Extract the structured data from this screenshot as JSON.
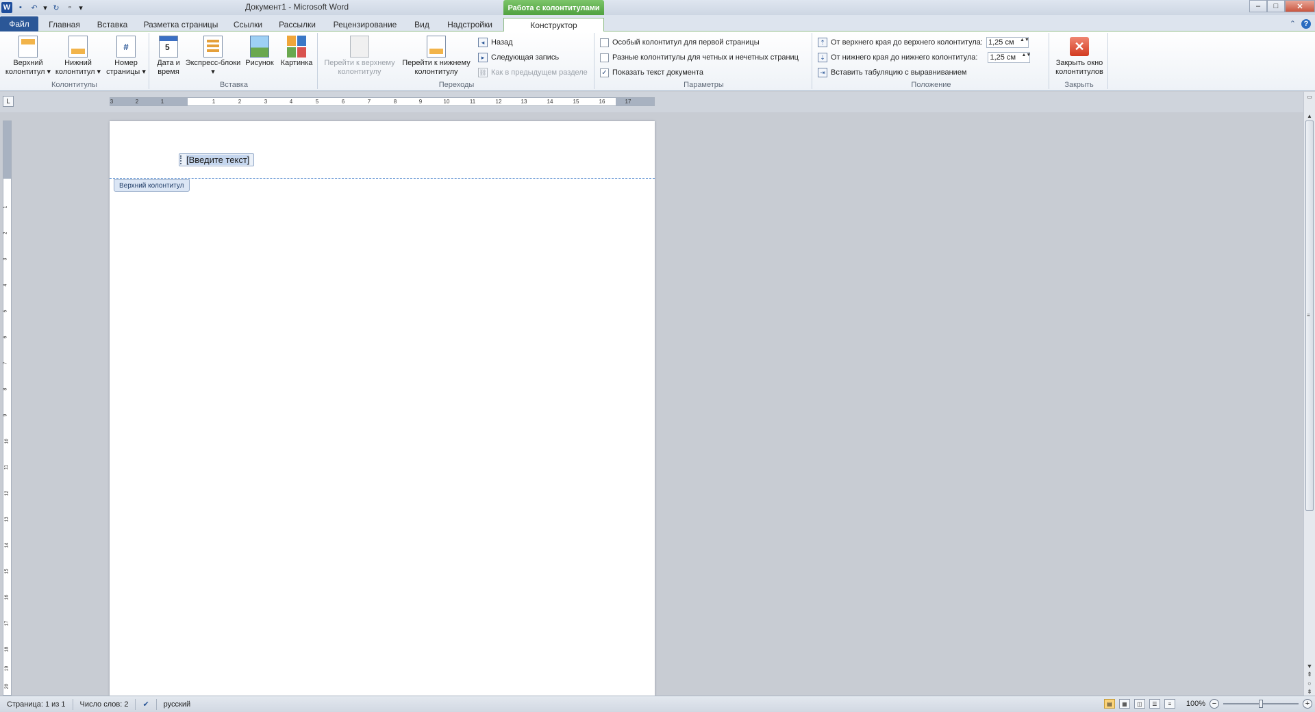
{
  "window": {
    "title": "Документ1 - Microsoft Word",
    "context_tab_title": "Работа с колонтитулами",
    "controls": {
      "minimize": "‒",
      "maximize": "□",
      "close": "✕"
    }
  },
  "qat": {
    "logo": "W",
    "save": "▪",
    "undo": "↶",
    "undo_dd": "▾",
    "redo": "↻",
    "new": "▫",
    "customize": "▾"
  },
  "tabs": {
    "file": "Файл",
    "items": [
      "Главная",
      "Вставка",
      "Разметка страницы",
      "Ссылки",
      "Рассылки",
      "Рецензирование",
      "Вид",
      "Надстройки",
      "Конструктор"
    ],
    "help_min": "⌃",
    "help_q": "?"
  },
  "ribbon": {
    "groups": {
      "headers_footers": {
        "label": "Колонтитулы",
        "header_btn": [
          "Верхний",
          "колонтитул ▾"
        ],
        "footer_btn": [
          "Нижний",
          "колонтитул ▾"
        ],
        "page_number_btn": [
          "Номер",
          "страницы ▾"
        ],
        "page_number_icon": "#"
      },
      "insert": {
        "label": "Вставка",
        "datetime_btn": [
          "Дата и",
          "время"
        ],
        "calendar_digit": "5",
        "quick_parts_btn": [
          "Экспресс-блоки",
          "▾"
        ],
        "picture_btn": "Рисунок",
        "clipart_btn": "Картинка"
      },
      "navigation": {
        "label": "Переходы",
        "goto_header_btn": [
          "Перейти к верхнему",
          "колонтитулу"
        ],
        "goto_footer_btn": [
          "Перейти к нижнему",
          "колонтитулу"
        ],
        "back": "Назад",
        "next": "Следующая запись",
        "link_previous": "Как в предыдущем разделе"
      },
      "options": {
        "label": "Параметры",
        "first_page": "Особый колонтитул для первой страницы",
        "odd_even": "Разные колонтитулы для четных и нечетных страниц",
        "show_doc_text": "Показать текст документа",
        "first_page_checked": false,
        "odd_even_checked": false,
        "show_doc_text_checked": true,
        "check_mark": "✓"
      },
      "position": {
        "label": "Положение",
        "header_from_top": "От верхнего края до верхнего колонтитула:",
        "header_from_top_value": "1,25 см",
        "footer_from_bottom": "От нижнего края до нижнего колонтитула:",
        "footer_from_bottom_value": "1,25 см",
        "insert_tab": "Вставить табуляцию с выравниванием",
        "spin_arrows": "▲▼"
      },
      "close": {
        "label": "Закрыть",
        "close_btn": [
          "Закрыть окно",
          "колонтитулов"
        ],
        "close_icon": "✕"
      }
    },
    "small_icons": {
      "back": "◂",
      "next": "▸",
      "link": "⛓",
      "top": "⇡",
      "bottom": "⇣",
      "tab": "⇥"
    }
  },
  "ruler": {
    "tab_selector": "L",
    "h_ticks": [
      "3",
      "2",
      "1",
      "1",
      "2",
      "3",
      "4",
      "5",
      "6",
      "7",
      "8",
      "9",
      "10",
      "11",
      "12",
      "13",
      "14",
      "15",
      "16",
      "17"
    ],
    "v_ticks": [
      "1",
      "2",
      "3",
      "4",
      "5",
      "6",
      "7",
      "8",
      "9",
      "10",
      "11",
      "12",
      "13",
      "14",
      "15",
      "16",
      "17",
      "18",
      "19",
      "20"
    ]
  },
  "document": {
    "header_placeholder": "[Введите текст]",
    "header_tag": "Верхний колонтитул"
  },
  "scrollbar": {
    "up": "▲",
    "down": "▼",
    "grip": "≡",
    "prev": "⇞",
    "select": "○",
    "next": "⇟",
    "ruler_toggle": "▭"
  },
  "statusbar": {
    "page": "Страница: 1 из 1",
    "words": "Число слов: 2",
    "proofing_icon": "✔",
    "language": "русский",
    "zoom": "100%",
    "zoom_out": "−",
    "zoom_in": "+",
    "views": [
      "▤",
      "▦",
      "◫",
      "☰",
      "≡"
    ]
  }
}
